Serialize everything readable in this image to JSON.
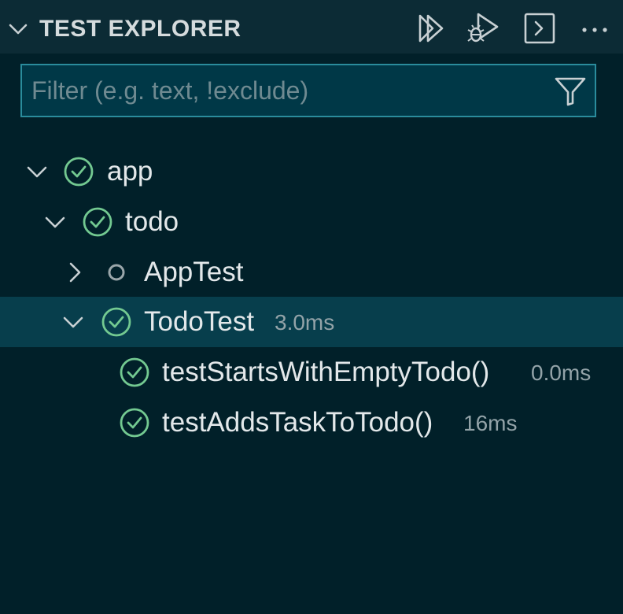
{
  "header": {
    "title": "TEST EXPLORER",
    "tools": [
      "run-tests-icon",
      "debug-tests-icon",
      "terminal-icon",
      "more-actions-icon"
    ]
  },
  "filter": {
    "value": "",
    "placeholder": "Filter (e.g. text, !exclude)"
  },
  "tree": {
    "app": {
      "label": "app",
      "status": "passed"
    },
    "todo": {
      "label": "todo",
      "status": "passed"
    },
    "app_test": {
      "label": "AppTest",
      "status": "not-run"
    },
    "todo_test": {
      "label": "TodoTest",
      "duration": "3.0ms",
      "status": "passed"
    },
    "test_empty": {
      "label": "testStartsWithEmptyTodo()",
      "duration": "0.0ms",
      "status": "passed"
    },
    "test_adds": {
      "label": "testAddsTaskToTodo()",
      "duration": "16ms",
      "status": "passed"
    }
  },
  "colors": {
    "background": "#012029",
    "header": "#0c2b35",
    "selected_row": "#073e4c",
    "passed": "#73c991",
    "not_run": "#9aa6aa",
    "filter_border": "#2a8c9c"
  }
}
